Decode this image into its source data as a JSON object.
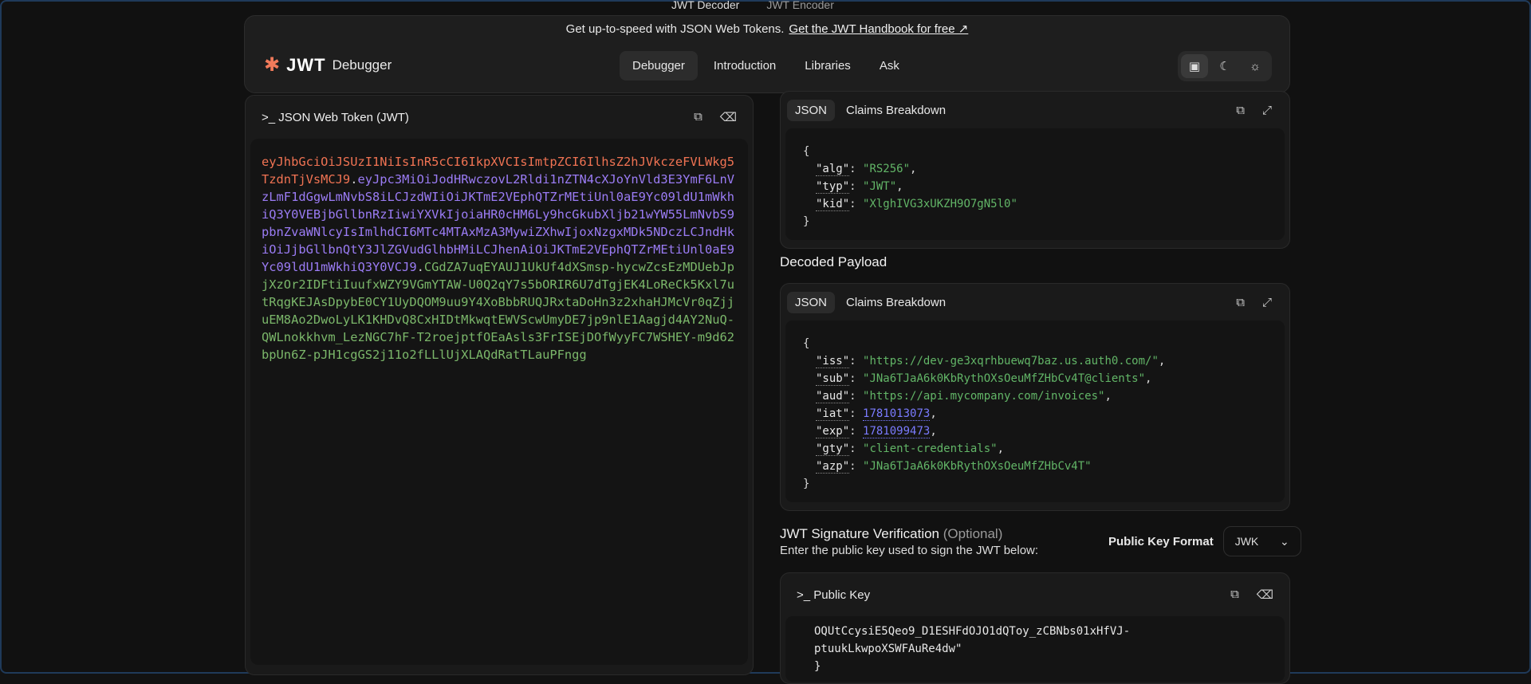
{
  "top_tabs": [
    "JWT Decoder",
    "JWT Encoder"
  ],
  "banner": {
    "text": "Get up-to-speed with JSON Web Tokens.",
    "link": "Get the JWT Handbook for free ↗"
  },
  "brand": {
    "logo": "JWT",
    "name": "Debugger"
  },
  "nav": [
    "Debugger",
    "Introduction",
    "Libraries",
    "Ask"
  ],
  "theme_icons": [
    "monitor-icon",
    "moon-icon",
    "sun-icon"
  ],
  "token_panel": {
    "title": ">_ JSON Web Token (JWT)",
    "header": "eyJhbGciOiJSUzI1NiIsInR5cCI6IkpXVCIsImtpZCI6IlhsZ2hJVkczeFVLWkg5TzdnTjVsMCJ9",
    "payload": "eyJpc3MiOiJodHRwczovL2Rldi1nZTN4cXJoYnVld3E3YmF6LnVzLmF1dGgwLmNvbS8iLCJzdWIiOiJKTmE2VEphQTZrMEtiUnl0aE9Yc09ldU1mWkhiQ3Y0VEBjbGllbnRzIiwiYXVkIjoiaHR0cHM6Ly9hcGkubXljb21wYW55LmNvbS9pbnZvaWNlcyIsImlhdCI6MTc4MTAxMzA3MywiZXhwIjoxNzgxMDk5NDczLCJndHkiOiJjbGllbnQtY3JlZGVudGlhbHMiLCJhenAiOiJKTmE2VEphQTZrMEtiUnl0aE9Yc09ldU1mWkhiQ3Y0VCJ9",
    "signature": "CGdZA7uqEYAUJ1UkUf4dXSmsp-hycwZcsEzMDUebJpjXzOr2IDFtiIuufxWZY9VGmYTAW-U0Q2qY7s5bORIR6U7dTgjEK4LoReCk5Kxl7utRqgKEJAsDpybE0CY1UyDQOM9uu9Y4XoBbbRUQJRxtaDoHn3z2xhaHJMcVr0qZjjuEM8Ao2DwoLyLK1KHDvQ8CxHIDtMkwqtEWVScwUmyDE7jp9nlE1Aagjd4AY2NuQ-QWLnokkhvm_LezNGC7hF-T2roejptfOEaAsls3FrISEjDOfWyyFC7WSHEY-m9d62bpUn6Z-pJH1cgGS2j11o2fLLlUjXLAQdRatTLauPFngg"
  },
  "header_card": {
    "tabs": [
      "JSON",
      "Claims Breakdown"
    ],
    "lines": [
      {
        "k": "alg",
        "v": "\"RS256\"",
        "t": "s",
        "c": ","
      },
      {
        "k": "typ",
        "v": "\"JWT\"",
        "t": "s",
        "c": ","
      },
      {
        "k": "kid",
        "v": "\"XlghIVG3xUKZH9O7gN5l0\"",
        "t": "s",
        "c": ""
      }
    ]
  },
  "payload_title": "Decoded Payload",
  "payload_card": {
    "tabs": [
      "JSON",
      "Claims Breakdown"
    ],
    "lines": [
      {
        "k": "iss",
        "v": "\"https://dev-ge3xqrhbuewq7baz.us.auth0.com/\"",
        "t": "s",
        "c": ","
      },
      {
        "k": "sub",
        "v": "\"JNa6TJaA6k0KbRythOXsOeuMfZHbCv4T@clients\"",
        "t": "s",
        "c": ","
      },
      {
        "k": "aud",
        "v": "\"https://api.mycompany.com/invoices\"",
        "t": "s",
        "c": ","
      },
      {
        "k": "iat",
        "v": "1781013073",
        "t": "n",
        "c": ","
      },
      {
        "k": "exp",
        "v": "1781099473",
        "t": "n",
        "c": ","
      },
      {
        "k": "gty",
        "v": "\"client-credentials\"",
        "t": "s",
        "c": ","
      },
      {
        "k": "azp",
        "v": "\"JNa6TJaA6k0KbRythOXsOeuMfZHbCv4T\"",
        "t": "s",
        "c": ""
      }
    ]
  },
  "verification": {
    "title": "JWT Signature Verification",
    "optional": "(Optional)",
    "subtitle": "Enter the public key used to sign the JWT below:",
    "format_label": "Public Key Format",
    "format_value": "JWK"
  },
  "public_key": {
    "title": ">_ Public Key",
    "lines": [
      "OQUtCcysiE5Qeo9_D1ESHFdOJO1dQToy_zCBNbs01xHfVJ-",
      "ptuukLkwpoXSWFAuRe4dw\"",
      "}"
    ]
  }
}
